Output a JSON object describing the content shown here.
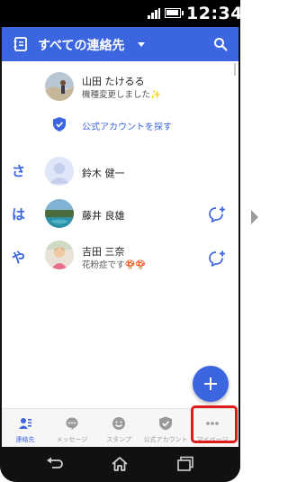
{
  "statusbar": {
    "time": "12:34"
  },
  "appbar": {
    "title": "すべての連絡先"
  },
  "contacts": [
    {
      "index": "",
      "name": "山田 たけるる",
      "status": "機種変更しました✨",
      "add_friend": false
    },
    {
      "index": "さ",
      "name": "鈴木 健一",
      "status": "",
      "add_friend": false
    },
    {
      "index": "は",
      "name": "藤井 良雄",
      "status": "",
      "add_friend": true
    },
    {
      "index": "や",
      "name": "吉田 三奈",
      "status": "花粉症です🍄🍄",
      "add_friend": true
    }
  ],
  "official_link": {
    "label": "公式アカウントを探す"
  },
  "tabs": [
    {
      "label": "連絡先",
      "icon": "contacts-icon",
      "active": true
    },
    {
      "label": "メッセージ",
      "icon": "message-icon",
      "active": false
    },
    {
      "label": "スタンプ",
      "icon": "sticker-icon",
      "active": false
    },
    {
      "label": "公式アカウント",
      "icon": "shield-icon",
      "active": false
    },
    {
      "label": "マイページ",
      "icon": "more-icon",
      "active": false
    }
  ],
  "colors": {
    "accent": "#3c65e0",
    "highlight": "#e11b1b"
  }
}
